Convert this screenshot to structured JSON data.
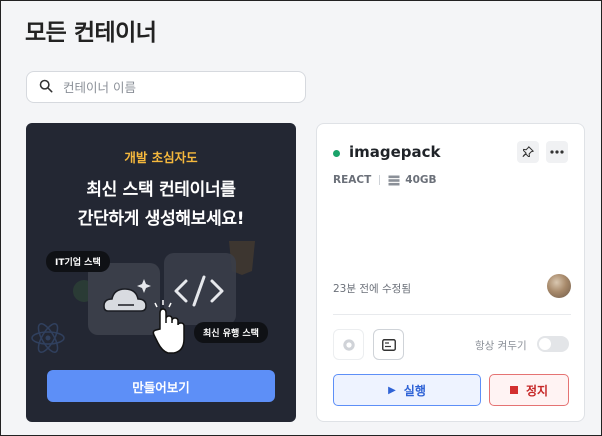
{
  "page": {
    "title": "모든 컨테이너"
  },
  "search": {
    "placeholder": "컨테이너 이름",
    "value": "",
    "icon": "search-icon"
  },
  "promo": {
    "eyebrow": "개발 초심자도",
    "headline_line1": "최신 스택 컨테이너를",
    "headline_line2": "간단하게 생성해보세요!",
    "bubble_stack": "IT기업 스택",
    "bubble_popular": "최신 유행 스택",
    "cta_label": "만들어보기",
    "colors": {
      "background": "#232733",
      "eyebrow": "#f5b83d",
      "cta": "#5d8ff7"
    }
  },
  "container": {
    "name": "imagepack",
    "status_color": "#1aa36a",
    "stack": "REACT",
    "disk": "40GB",
    "edited": "23분 전에 수정됨",
    "always_on_label": "항상 켜두기",
    "always_on": false,
    "run_label": "실행",
    "stop_label": "정지"
  }
}
